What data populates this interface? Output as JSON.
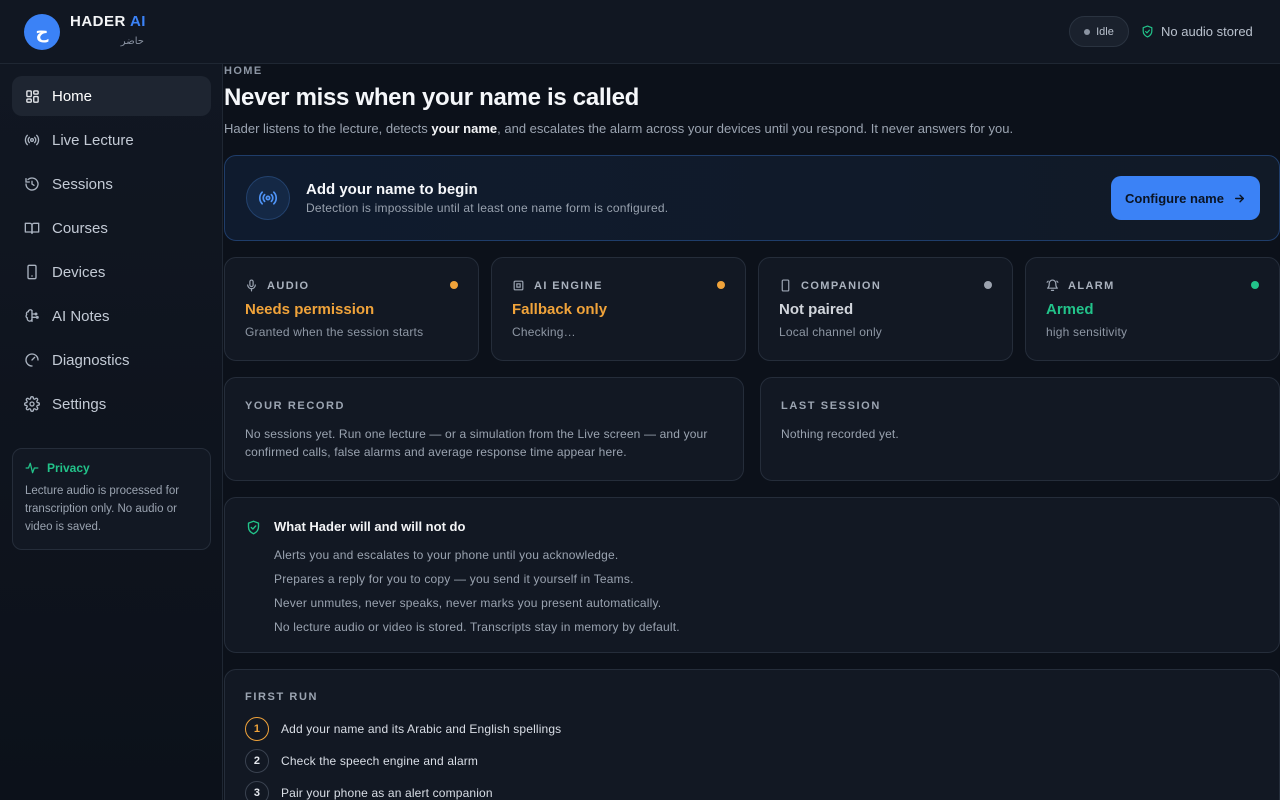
{
  "header": {
    "logo_glyph": "ح",
    "brand_name": "HADER",
    "brand_accent": "AI",
    "brand_sub": "حاضر",
    "status_pill": "Idle",
    "storage_status": "No audio stored"
  },
  "sidebar": {
    "items": [
      {
        "label": "Home",
        "icon": "grid-icon"
      },
      {
        "label": "Live Lecture",
        "icon": "broadcast-icon"
      },
      {
        "label": "Sessions",
        "icon": "history-icon"
      },
      {
        "label": "Courses",
        "icon": "book-icon"
      },
      {
        "label": "Devices",
        "icon": "phone-icon"
      },
      {
        "label": "AI Notes",
        "icon": "brain-icon"
      },
      {
        "label": "Diagnostics",
        "icon": "gauge-icon"
      },
      {
        "label": "Settings",
        "icon": "gear-icon"
      }
    ],
    "privacy": {
      "title": "Privacy",
      "text": "Lecture audio is processed for transcription only. No audio or video is saved."
    }
  },
  "main": {
    "eyebrow": "HOME",
    "title": "Never miss when your name is called",
    "subtitle_pre": "Hader listens to the lecture, detects ",
    "subtitle_bold": "your name",
    "subtitle_post": ", and escalates the alarm across your devices until you respond. It never answers for you.",
    "banner": {
      "title": "Add your name to begin",
      "subtitle": "Detection is impossible until at least one name form is configured.",
      "button": "Configure name"
    },
    "status_cards": [
      {
        "label": "AUDIO",
        "value": "Needs permission",
        "detail": "Granted when the session starts",
        "color": "#f0a33a",
        "icon": "microphone-icon"
      },
      {
        "label": "AI ENGINE",
        "value": "Fallback only",
        "detail": "Checking…",
        "color": "#f0a33a",
        "icon": "cpu-icon"
      },
      {
        "label": "COMPANION",
        "value": "Not paired",
        "detail": "Local channel only",
        "color": "#d1d5db",
        "icon": "phone-icon"
      },
      {
        "label": "ALARM",
        "value": "Armed",
        "detail": "high sensitivity",
        "color": "#22c38a",
        "icon": "bell-icon"
      }
    ],
    "record": {
      "label": "YOUR RECORD",
      "text": "No sessions yet. Run one lecture — or a simulation from the Live screen — and your confirmed calls, false alarms and average response time appear here."
    },
    "last_session": {
      "label": "LAST SESSION",
      "text": "Nothing recorded yet."
    },
    "will_card": {
      "title": "What Hader will and will not do",
      "items": [
        "Alerts you and escalates to your phone until you acknowledge.",
        "Prepares a reply for you to copy — you send it yourself in Teams.",
        "Never unmutes, never speaks, never marks you present automatically.",
        "No lecture audio or video is stored. Transcripts stay in memory by default."
      ]
    },
    "first_run": {
      "label": "FIRST RUN",
      "steps": [
        {
          "num": "1",
          "text": "Add your name and its Arabic and English spellings"
        },
        {
          "num": "2",
          "text": "Check the speech engine and alarm"
        },
        {
          "num": "3",
          "text": "Pair your phone as an alert companion"
        }
      ]
    }
  },
  "colors": {
    "accent": "#3b82f6",
    "warning": "#f0a33a",
    "success": "#22c38a",
    "neutral": "#8a93a1"
  }
}
